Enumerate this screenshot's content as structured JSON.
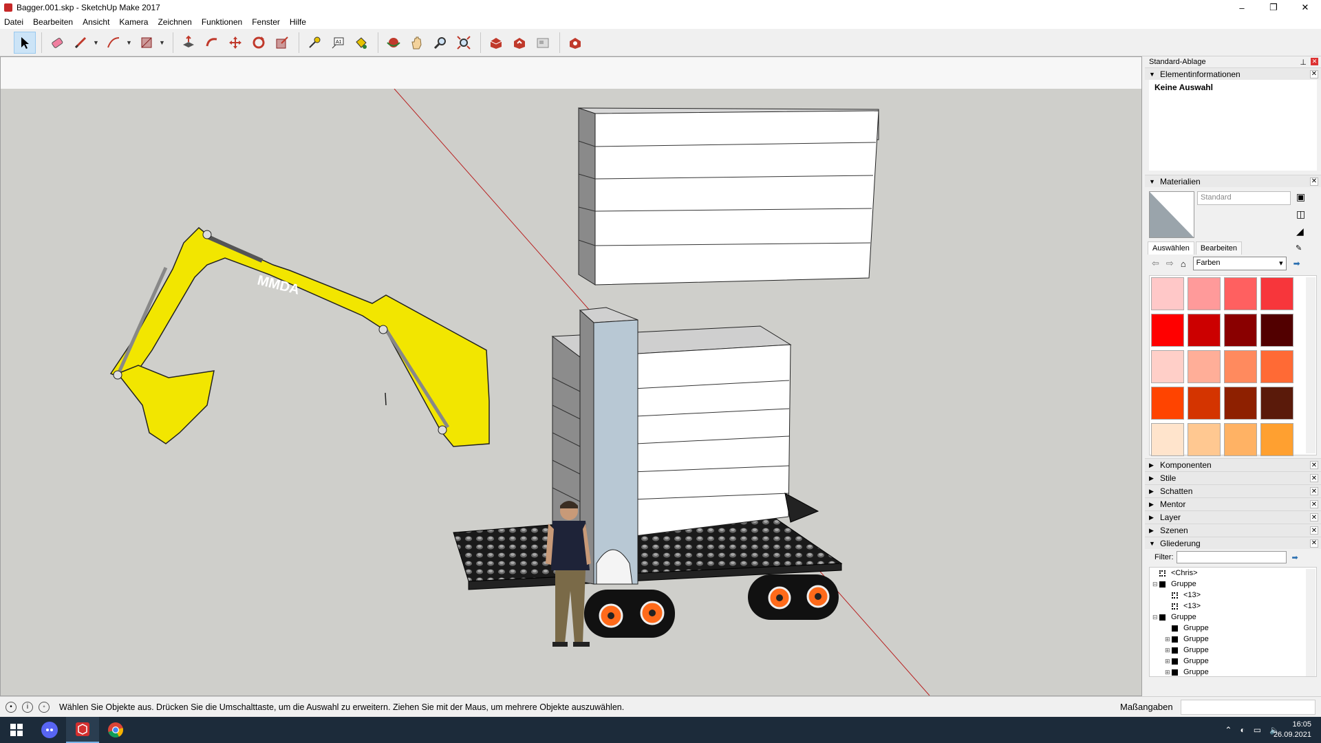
{
  "window": {
    "title": "Bagger.001.skp - SketchUp Make 2017",
    "minimize": "–",
    "maximize": "❐",
    "close": "✕"
  },
  "menu": [
    "Datei",
    "Bearbeiten",
    "Ansicht",
    "Kamera",
    "Zeichnen",
    "Funktionen",
    "Fenster",
    "Hilfe"
  ],
  "model_text": "MMDA",
  "tray": {
    "title": "Standard-Ablage",
    "entity_info": {
      "header": "Elementinformationen",
      "selection": "Keine Auswahl"
    },
    "materials": {
      "header": "Materialien",
      "name": "Standard",
      "tab_select": "Auswählen",
      "tab_edit": "Bearbeiten",
      "library": "Farben",
      "swatches": [
        "#ffc8c8",
        "#ff9a9a",
        "#ff6060",
        "#f7363b",
        "#ff0000",
        "#cc0000",
        "#8a0000",
        "#520000",
        "#ffcfc8",
        "#ffae98",
        "#ff8a5e",
        "#ff6a35",
        "#ff4400",
        "#d43400",
        "#8e2000",
        "#5a1a0a",
        "#ffe4cc",
        "#ffc891",
        "#ffb264",
        "#ffa030"
      ]
    },
    "collapsed_panels": [
      "Komponenten",
      "Stile",
      "Schatten",
      "Mentor",
      "Layer",
      "Szenen"
    ],
    "outliner": {
      "header": "Gliederung",
      "filter_label": "Filter:",
      "rows": [
        {
          "label": "<Chris>",
          "type": "component",
          "indent": 0,
          "expander": ""
        },
        {
          "label": "Gruppe",
          "type": "group",
          "indent": 0,
          "expander": "⊟"
        },
        {
          "label": "<13>",
          "type": "component",
          "indent": 1,
          "expander": ""
        },
        {
          "label": "<13>",
          "type": "component",
          "indent": 1,
          "expander": ""
        },
        {
          "label": "Gruppe",
          "type": "group",
          "indent": 0,
          "expander": "⊟"
        },
        {
          "label": "Gruppe",
          "type": "group",
          "indent": 1,
          "expander": ""
        },
        {
          "label": "Gruppe",
          "type": "group",
          "indent": 1,
          "expander": "⊞"
        },
        {
          "label": "Gruppe",
          "type": "group",
          "indent": 1,
          "expander": "⊞"
        },
        {
          "label": "Gruppe",
          "type": "group",
          "indent": 1,
          "expander": "⊞"
        },
        {
          "label": "Gruppe",
          "type": "group",
          "indent": 1,
          "expander": "⊞"
        }
      ]
    }
  },
  "status": {
    "text": "Wählen Sie Objekte aus. Drücken Sie die Umschalttaste, um die Auswahl zu erweitern. Ziehen Sie mit der Maus, um mehrere Objekte auszuwählen.",
    "measure_label": "Maßangaben",
    "measure_value": ""
  },
  "taskbar": {
    "time": "16:05",
    "date": "26.09.2021"
  }
}
